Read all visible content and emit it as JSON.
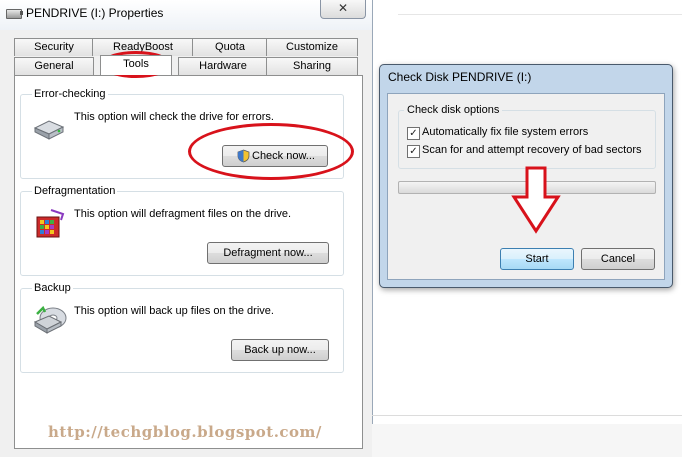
{
  "properties_window": {
    "title": "PENDRIVE (I:) Properties",
    "close_glyph": "✕",
    "tabs_back": [
      "Security",
      "ReadyBoost",
      "Quota",
      "Customize"
    ],
    "tabs_front": [
      "General",
      "Tools",
      "Hardware",
      "Sharing"
    ],
    "active_tab": "Tools",
    "sections": {
      "error_checking": {
        "label": "Error-checking",
        "description": "This option will check the drive for errors.",
        "button": "Check now...",
        "icon": "drive-check-icon"
      },
      "defragmentation": {
        "label": "Defragmentation",
        "description": "This option will defragment files on the drive.",
        "button": "Defragment now...",
        "icon": "defragment-icon"
      },
      "backup": {
        "label": "Backup",
        "description": "This option will back up files on the drive.",
        "button": "Back up now...",
        "icon": "backup-icon"
      }
    }
  },
  "check_disk_dialog": {
    "title": "Check Disk PENDRIVE (I:)",
    "group_label": "Check disk options",
    "options": [
      {
        "label": "Automatically fix file system errors",
        "checked": true,
        "mark": "✓"
      },
      {
        "label": "Scan for and attempt recovery of bad sectors",
        "checked": true,
        "mark": "✓"
      }
    ],
    "progress": 0,
    "start_button": "Start",
    "cancel_button": "Cancel"
  },
  "watermark": "http://techgblog.blogspot.com/",
  "colors": {
    "annotation_red": "#d8121b",
    "button_focus_blue": "#3c7fb1"
  }
}
